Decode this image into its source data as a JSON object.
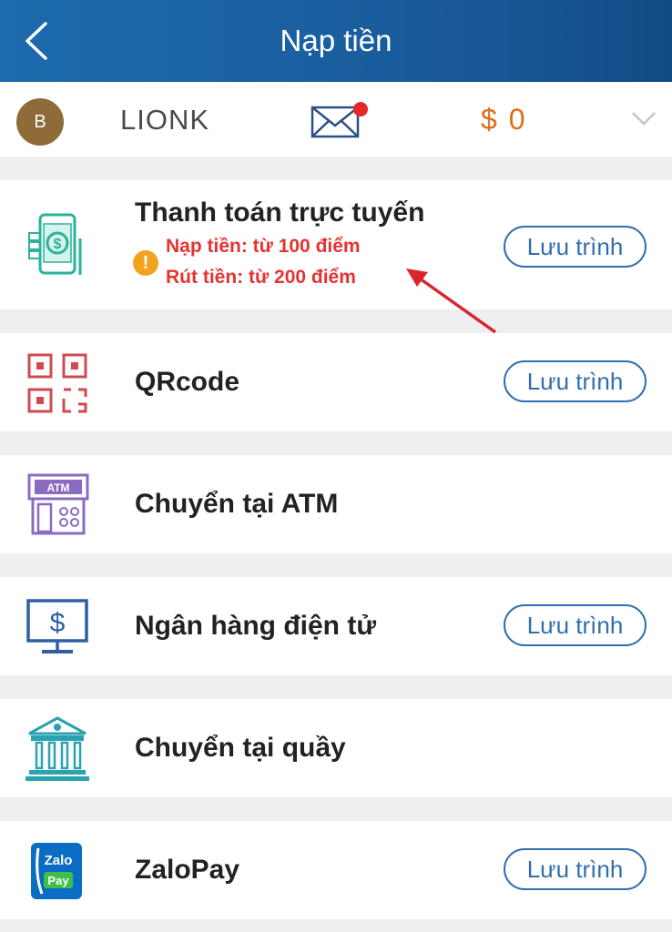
{
  "header": {
    "title": "Nạp tiền"
  },
  "user": {
    "avatar_letter": "B",
    "name": "LIONK",
    "balance": "$ 0"
  },
  "methods": [
    {
      "label": "Thanh toán trực tuyến",
      "button": "Lưu trình",
      "notes": [
        "Nạp tiền: từ 100 điểm",
        "Rút tiền: từ 200 điểm"
      ],
      "warn_glyph": "!"
    },
    {
      "label": "QRcode",
      "button": "Lưu trình"
    },
    {
      "label": "Chuyển tại ATM"
    },
    {
      "label": "Ngân hàng điện tử",
      "button": "Lưu trình"
    },
    {
      "label": "Chuyển tại quầy"
    },
    {
      "label": "ZaloPay",
      "button": "Lưu trình"
    }
  ],
  "icons": {
    "atm_text": "ATM",
    "zalo_text": "Zalo",
    "pay_text": "Pay",
    "dollar": "$"
  },
  "colors": {
    "header": "#1a5fa0",
    "balance": "#e06b18",
    "button_border": "#2f6fb0",
    "note": "#e53332"
  }
}
